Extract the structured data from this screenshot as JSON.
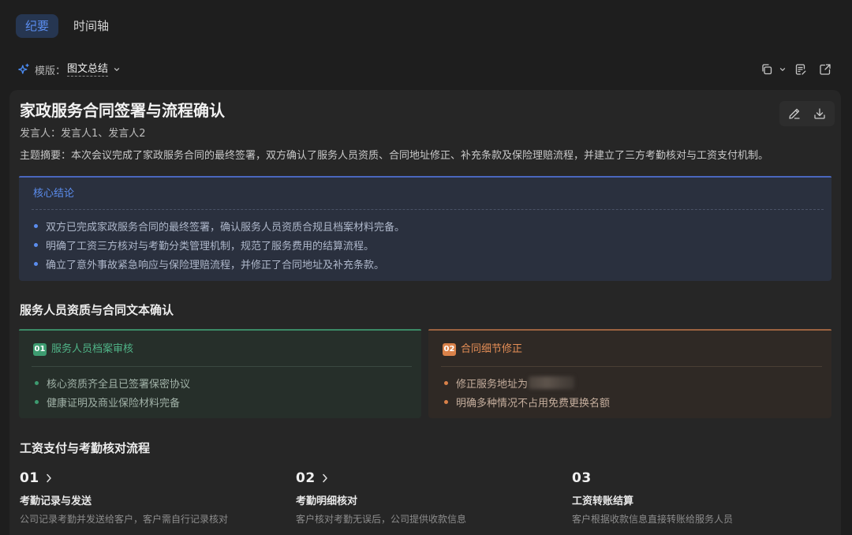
{
  "tabs": [
    {
      "label": "纪要",
      "active": true
    },
    {
      "label": "时间轴",
      "active": false
    }
  ],
  "template": {
    "icon": "sparkle-icon",
    "prefix": "模版：",
    "value": "图文总结"
  },
  "toolbar": {
    "icons": [
      "copy-icon",
      "chevron-down-icon",
      "notes-icon",
      "external-link-icon"
    ]
  },
  "colors": {
    "page_bg": "#1e1e1e",
    "card_bg": "#262626",
    "core_bg": "#2a303e",
    "accent": "#5b8def",
    "green": "#3d9b70",
    "orange": "#d98149"
  },
  "summary": {
    "title": "家政服务合同签署与流程确认",
    "actions": [
      "edit-icon",
      "download-icon"
    ],
    "speakers_label": "发言人：",
    "speakers": "发言人1、发言人2",
    "abstract_label": "主题摘要：",
    "abstract": "本次会议完成了家政服务合同的最终签署，双方确认了服务人员资质、合同地址修正、补充条款及保险理赔流程，并建立了三方考勤核对与工资支付机制。"
  },
  "core": {
    "label": "核心结论",
    "items": [
      "双方已完成家政服务合同的最终签署，确认服务人员资质合规且档案材料完备。",
      "明确了工资三方核对与考勤分类管理机制，规范了服务费用的结算流程。",
      "确立了意外事故紧急响应与保险理赔流程，并修正了合同地址及补充条款。"
    ]
  },
  "qualification_section": {
    "heading": "服务人员资质与合同文本确认",
    "cards": [
      {
        "badge": "01",
        "title": "服务人员档案审核",
        "items": [
          "核心资质齐全且已签署保密协议",
          "健康证明及商业保险材料完备"
        ]
      },
      {
        "badge": "02",
        "title": "合同细节修正",
        "items": [
          "修正服务地址为",
          "明确多种情况不占用免费更换名额"
        ]
      }
    ]
  },
  "payment_section": {
    "heading": "工资支付与考勤核对流程",
    "steps": [
      {
        "number": "01",
        "title": "考勤记录与发送",
        "desc": "公司记录考勤并发送给客户，客户需自行记录核对"
      },
      {
        "number": "02",
        "title": "考勤明细核对",
        "desc": "客户核对考勤无误后，公司提供收款信息"
      },
      {
        "number": "03",
        "title": "工资转账结算",
        "desc": "客户根据收款信息直接转账给服务人员"
      }
    ]
  }
}
